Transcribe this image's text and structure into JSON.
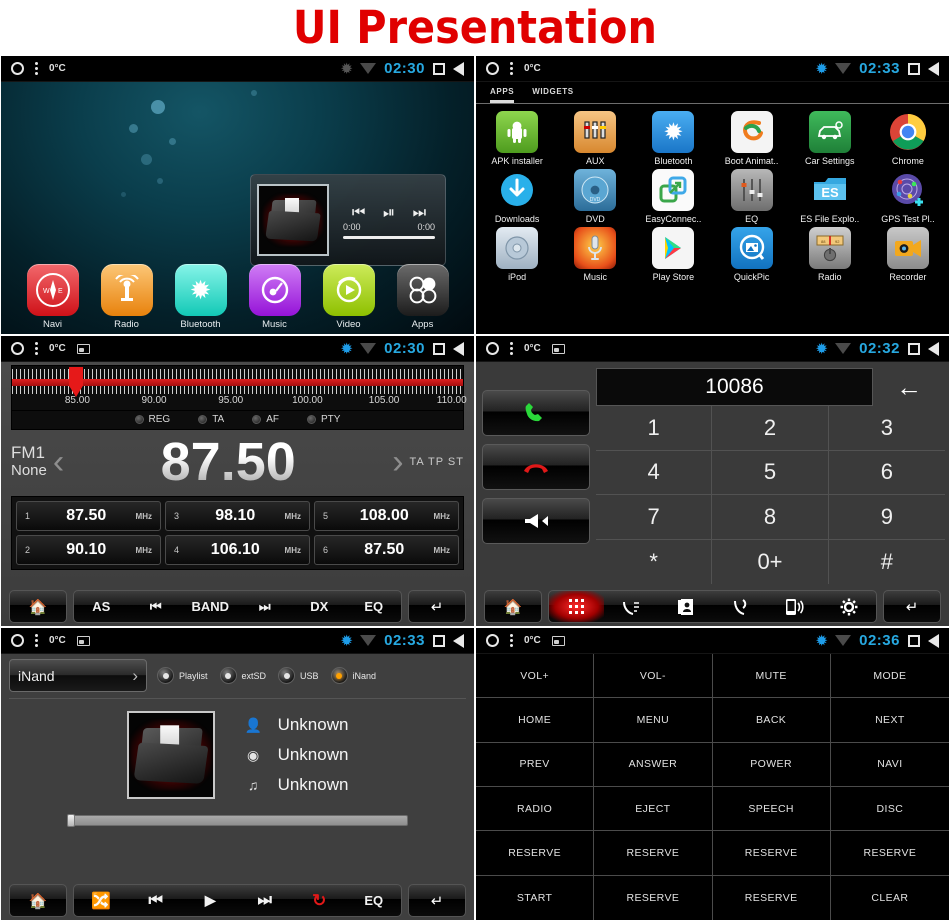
{
  "title": "UI Presentation",
  "title_color": "#e00000",
  "status": {
    "home_icon": "circle-icon",
    "menu_icon": "three-dots-icon",
    "temperature": "0°C",
    "screenshot_icon": "screenshot-icon",
    "bluetooth_icon": "bluetooth-icon",
    "wifi_icon": "wifi-icon",
    "recents_icon": "square-icon",
    "back_icon": "back-triangle-icon"
  },
  "panels": {
    "home": {
      "time": "02:30",
      "temperature": "0°C",
      "widget": {
        "prev_icon": "skip-previous-icon",
        "play_icon": "play-pause-icon",
        "next_icon": "skip-next-icon",
        "elapsed": "0:00",
        "duration": "0:00"
      },
      "dock": [
        {
          "label": "Navi",
          "icon": "compass-icon",
          "color": "#e8353b"
        },
        {
          "label": "Radio",
          "icon": "antenna-icon",
          "color": "#f0a02a"
        },
        {
          "label": "Bluetooth",
          "icon": "bluetooth-icon",
          "color": "#3ee0d0"
        },
        {
          "label": "Music",
          "icon": "disc-note-icon",
          "color": "#b23cf0"
        },
        {
          "label": "Video",
          "icon": "play-circle-icon",
          "color": "#a8d62a"
        },
        {
          "label": "Apps",
          "icon": "apps-grid-icon",
          "color": "#3c3c3c"
        }
      ]
    },
    "apps": {
      "time": "02:33",
      "temperature": "0°C",
      "tabs": [
        {
          "label": "APPS",
          "active": true
        },
        {
          "label": "WIDGETS",
          "active": false
        }
      ],
      "items": [
        {
          "label": "APK installer",
          "icon": "android-icon",
          "color": "#6fbd2e"
        },
        {
          "label": "AUX",
          "icon": "rca-jacks-icon",
          "color": "#e8a85c"
        },
        {
          "label": "Bluetooth",
          "icon": "bluetooth-icon",
          "color": "#2a8fe0"
        },
        {
          "label": "Boot Animat..",
          "icon": "boot-anim-icon",
          "color": "#f2f2f2"
        },
        {
          "label": "Car Settings",
          "icon": "car-gear-icon",
          "color": "#2e9c4a"
        },
        {
          "label": "Chrome",
          "icon": "chrome-icon",
          "color": "#f2f2f2"
        },
        {
          "label": "Downloads",
          "icon": "download-icon",
          "color": "#22a7e8"
        },
        {
          "label": "DVD",
          "icon": "dvd-disc-icon",
          "color": "#4a8fc2"
        },
        {
          "label": "EasyConnec..",
          "icon": "easyconnect-icon",
          "color": "#fafafa"
        },
        {
          "label": "EQ",
          "icon": "equalizer-icon",
          "color": "#9a9a9a"
        },
        {
          "label": "ES File Explo..",
          "icon": "es-folder-icon",
          "color": "#2fa8e0"
        },
        {
          "label": "GPS Test Pl..",
          "icon": "gps-radar-icon",
          "color": "#6a4fb0"
        },
        {
          "label": "iPod",
          "icon": "ipod-icon",
          "color": "#c9d6e2"
        },
        {
          "label": "Music",
          "icon": "microphone-icon",
          "color": "#e8601f"
        },
        {
          "label": "Play Store",
          "icon": "play-store-icon",
          "color": "#fafafa"
        },
        {
          "label": "QuickPic",
          "icon": "quickpic-icon",
          "color": "#1e90e0"
        },
        {
          "label": "Radio",
          "icon": "radio-dial-icon",
          "color": "#9e9e9e"
        },
        {
          "label": "Recorder",
          "icon": "camcorder-icon",
          "color": "#f0a81e"
        }
      ]
    },
    "radio": {
      "time": "02:30",
      "temperature": "0°C",
      "scale_labels": [
        "85.00",
        "90.00",
        "95.00",
        "100.00",
        "105.00",
        "110.00"
      ],
      "scale_min": 83.0,
      "scale_max": 112.0,
      "needle_frequency": "87.50",
      "rds_options": [
        {
          "label": "REG",
          "on": false
        },
        {
          "label": "TA",
          "on": false
        },
        {
          "label": "AF",
          "on": false
        },
        {
          "label": "PTY",
          "on": false
        }
      ],
      "band": "FM1",
      "station_name": "None",
      "frequency": "87.50",
      "prev_icon": "chevron-left-icon",
      "next_icon": "chevron-right-icon",
      "indicators": "TA TP ST",
      "presets": [
        {
          "num": "1",
          "freq": "87.50",
          "unit": "MHz"
        },
        {
          "num": "3",
          "freq": "98.10",
          "unit": "MHz"
        },
        {
          "num": "5",
          "freq": "108.00",
          "unit": "MHz"
        },
        {
          "num": "2",
          "freq": "90.10",
          "unit": "MHz"
        },
        {
          "num": "4",
          "freq": "106.10",
          "unit": "MHz"
        },
        {
          "num": "6",
          "freq": "87.50",
          "unit": "MHz"
        }
      ],
      "toolbar": {
        "home_icon": "home-icon",
        "items": [
          {
            "label": "AS",
            "icon": null
          },
          {
            "label": null,
            "icon": "skip-previous-icon"
          },
          {
            "label": "BAND",
            "icon": null
          },
          {
            "label": null,
            "icon": "skip-next-icon"
          },
          {
            "label": "DX",
            "icon": null
          },
          {
            "label": "EQ",
            "icon": null
          }
        ],
        "back_icon": "return-arrow-icon"
      }
    },
    "phone": {
      "time": "02:32",
      "temperature": "0°C",
      "dialed_number": "10086",
      "backspace_icon": "backspace-arrow-icon",
      "call_icon": "call-answer-icon",
      "hangup_icon": "call-end-icon",
      "mute_icon": "speaker-mute-icon",
      "keys": [
        "1",
        "2",
        "3",
        "4",
        "5",
        "6",
        "7",
        "8",
        "9",
        "*",
        "0+",
        "#"
      ],
      "toolbar": {
        "home_icon": "home-icon",
        "items": [
          {
            "icon": "keypad-icon",
            "active": true
          },
          {
            "icon": "call-log-icon",
            "active": false
          },
          {
            "icon": "contacts-book-icon",
            "active": false
          },
          {
            "icon": "call-sync-icon",
            "active": false
          },
          {
            "icon": "phone-signal-icon",
            "active": false
          },
          {
            "icon": "gear-icon",
            "active": false
          }
        ],
        "back_icon": "return-arrow-icon"
      }
    },
    "music": {
      "time": "02:33",
      "temperature": "0°C",
      "source_selected": "iNand",
      "source_chevron": "chevron-right-icon",
      "sources": [
        {
          "label": "Playlist",
          "on": false
        },
        {
          "label": "extSD",
          "on": false
        },
        {
          "label": "USB",
          "on": false
        },
        {
          "label": "iNand",
          "on": true
        }
      ],
      "meta": [
        {
          "icon": "artist-icon",
          "value": "Unknown"
        },
        {
          "icon": "album-icon",
          "value": "Unknown"
        },
        {
          "icon": "track-icon",
          "value": "Unknown"
        }
      ],
      "progress_percent": 1,
      "toolbar": {
        "home_icon": "home-icon",
        "items": [
          {
            "icon": "shuffle-icon",
            "active": false,
            "label": null
          },
          {
            "icon": "skip-previous-icon",
            "active": false,
            "label": null
          },
          {
            "icon": "play-icon",
            "active": false,
            "label": null
          },
          {
            "icon": "skip-next-icon",
            "active": false,
            "label": null
          },
          {
            "icon": "repeat-icon",
            "active": true,
            "label": null
          },
          {
            "icon": null,
            "active": false,
            "label": "EQ"
          }
        ],
        "back_icon": "return-arrow-icon"
      }
    },
    "swc": {
      "time": "02:36",
      "temperature": "0°C",
      "keys": [
        "VOL+",
        "VOL-",
        "MUTE",
        "MODE",
        "HOME",
        "MENU",
        "BACK",
        "NEXT",
        "PREV",
        "ANSWER",
        "POWER",
        "NAVI",
        "RADIO",
        "EJECT",
        "SPEECH",
        "DISC",
        "RESERVE",
        "RESERVE",
        "RESERVE",
        "RESERVE",
        "START",
        "RESERVE",
        "RESERVE",
        "CLEAR"
      ]
    }
  }
}
